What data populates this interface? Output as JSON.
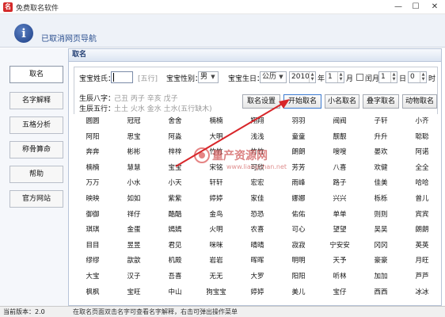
{
  "window": {
    "title": "免费取名软件",
    "app_icon_char": "名",
    "minimize": "—",
    "maximize": "☐",
    "close": "✕"
  },
  "header": {
    "nav_text": "已取消网页导航"
  },
  "sidebar": {
    "items": [
      {
        "label": "取名"
      },
      {
        "label": "名字解释"
      },
      {
        "label": "五格分析"
      },
      {
        "label": "称骨算命"
      },
      {
        "label": "帮助"
      },
      {
        "label": "官方网站"
      }
    ]
  },
  "panel": {
    "title": "取名"
  },
  "form": {
    "surname_label": "宝宝姓氏：",
    "surname_value": "",
    "surname_hint": "[五行]",
    "gender_label": "宝宝性别：",
    "gender_value": "男",
    "birthday_label": "宝宝生日：",
    "calendar_value": "公历",
    "year_value": "2010",
    "year_unit": "年",
    "month_value": "1",
    "month_unit": "月",
    "leap_label": "闰月",
    "day_value": "1",
    "day_unit": "日",
    "hour_value": "0",
    "hour_unit": "时",
    "bazi_label": "生辰八字：",
    "bazi_value": "己丑 丙子 辛亥 戊子",
    "wuxing_label": "生辰五行：",
    "wuxing_value": "土土 火水 金水 土水(五行缺木)"
  },
  "actions": {
    "settings": "取名设置",
    "start": "开始取名",
    "nickname": "小名取名",
    "four_char": "叠字取名",
    "animal": "动物取名"
  },
  "names": [
    [
      "圆圆",
      "冠冠",
      "舍舍",
      "楠楠",
      "翔翔",
      "羽羽",
      "阀阀",
      "子轩",
      "小齐"
    ],
    [
      "阿阳",
      "思宝",
      "阿淼",
      "大明",
      "浅浅",
      "童童",
      "靓靓",
      "升升",
      "聪聪"
    ],
    [
      "奔奔",
      "彬彬",
      "梓梓",
      "竹竹",
      "竹竹",
      "朗朗",
      "嗖嗖",
      "晏欢",
      "阿诺",
      "火龙"
    ],
    [
      "楠楠",
      "慧慧",
      "宝宝",
      "宋铭",
      "可欣",
      "芳芳",
      "八喜",
      "欢健",
      "全全"
    ],
    [
      "万万",
      "小水",
      "小天",
      "轩轩",
      "宏宏",
      "雨峰",
      "路子",
      "佳美",
      "哈哈"
    ],
    [
      "映映",
      "如如",
      "紫紫",
      "婷婷",
      "家佳",
      "娜娜",
      "兴兴",
      "栎栎",
      "曾儿"
    ],
    [
      "御御",
      "祥仔",
      "酷酷",
      "金鸟",
      "恐恐",
      "佑佑",
      "单单",
      "则则",
      "宾宾"
    ],
    [
      "琪琪",
      "金蛋",
      "嫣嫣",
      "火明",
      "农喜",
      "可心",
      "望望",
      "吴吴",
      "朗朗"
    ],
    [
      "目目",
      "昱昱",
      "君见",
      "咪咪",
      "晴晴",
      "寂寂",
      "宁安安",
      "冈冈",
      "英英"
    ],
    [
      "缪缪",
      "歆歆",
      "机殿",
      "岩岩",
      "晖晖",
      "明明",
      "天予",
      "豪豪",
      "月旺"
    ],
    [
      "大宝",
      "汉子",
      "吾喜",
      "无无",
      "大罗",
      "阳阳",
      "听林",
      "加加",
      "芦芦"
    ],
    [
      "枫枫",
      "宝旺",
      "中山",
      "狗宝宝",
      "婷婷",
      "美儿",
      "宝仔",
      "西西",
      "冰冰"
    ]
  ],
  "status": {
    "version": "当前版本：2.0",
    "tip": "在取名页面双击名字可查看名字解释，右击可弹出操作菜单"
  },
  "watermark": {
    "text": "量产资源网",
    "url": "www.liangchan.net"
  },
  "colors": {
    "accent": "#2a4f8f",
    "arrow": "#d8262a",
    "panel_border": "#b7c4d8"
  }
}
